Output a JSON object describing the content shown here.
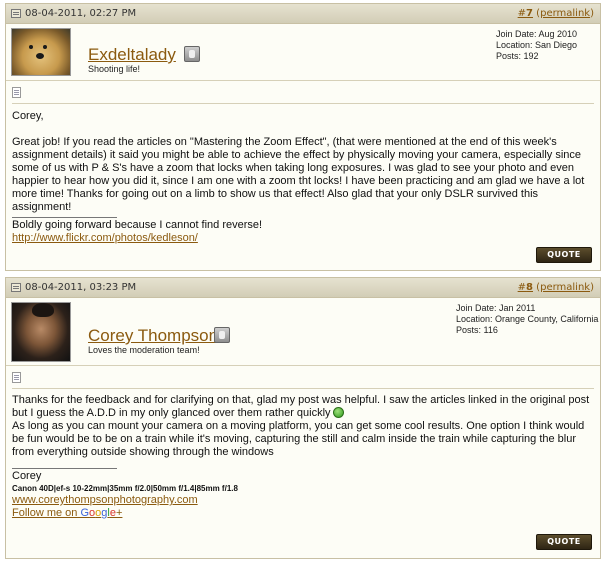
{
  "posts": [
    {
      "date": "08-04-2011, 02:27 PM",
      "number": "7",
      "permalink": "permalink",
      "username": "Exdeltalady",
      "user_title": "Shooting life!",
      "join_date": "Join Date: Aug 2010",
      "location": "Location: San Diego",
      "posts": "Posts: 192",
      "greeting": "Corey,",
      "message": "Great job! If you read the articles on \"Mastering the Zoom Effect\", (that were mentioned at the end of this week's assignment details) it said you might be able to achieve the effect by physically moving your camera, especially since some of us with P & S's have a zoom that locks when taking long exposures. I was glad to see your photo and even happier to hear how you did it, since I am one with a zoom tht locks! I have been practicing and am glad we have a lot more time! Thanks for going out on a limb to show us that effect! Also glad that your only DSLR survived this assignment!",
      "signature_line": "Boldly going forward because I cannot find reverse!",
      "signature_link": "http://www.flickr.com/photos/kedleson/",
      "quote_label": "QUOTE"
    },
    {
      "date": "08-04-2011, 03:23 PM",
      "number": "8",
      "permalink": "permalink",
      "username": "Corey Thompson",
      "user_title": "Loves the moderation team!",
      "join_date": "Join Date: Jan 2011",
      "location": "Location: Orange County, California",
      "posts": "Posts: 116",
      "message_p1": "Thanks for the feedback and for clarifying on that, glad my post was helpful. I saw the articles linked in the original post but I guess the A.D.D in my only glanced over them rather quickly",
      "message_p2": "As long as you can mount your camera on a moving platform, you can get some cool results. One option I think would be fun would be to be on a train while it's moving, capturing the still and calm inside the train while capturing the blur from everything outside showing through the windows",
      "signature_name": "Corey",
      "signature_gear": "Canon 40D|ef-s 10-22mm|35mm f/2.0|50mm f/1.4|85mm f/1.8",
      "signature_site": "www.coreythompsonphotography.com",
      "follow_prefix": "Follow me on ",
      "follow_g1": "G",
      "follow_g2": "o",
      "follow_g3": "o",
      "follow_g4": "g",
      "follow_g5": "l",
      "follow_g6": "e",
      "follow_g7": "+",
      "quote_label": "QUOTE"
    }
  ]
}
